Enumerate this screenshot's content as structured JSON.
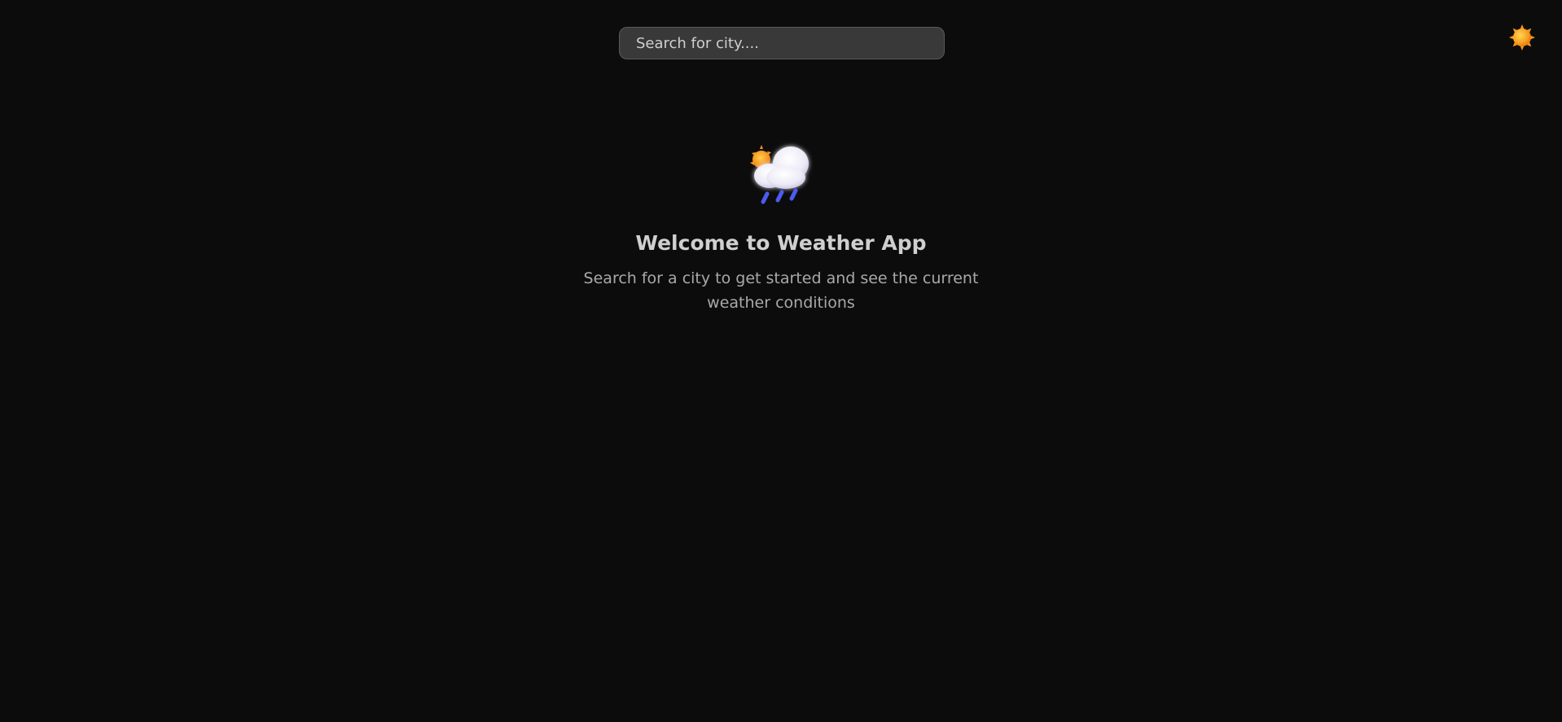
{
  "search": {
    "placeholder": "Search for city....",
    "value": ""
  },
  "header": {
    "theme_toggle_icon": "sun-icon"
  },
  "welcome": {
    "icon": "cloud-sun-rain-icon",
    "title": "Welcome to Weather App",
    "subtitle": "Search for a city to get started and see the current weather conditions"
  },
  "colors": {
    "background": "#0d0c0c",
    "search_bg": "#3a3939",
    "sun": "#f5a623",
    "rain": "#4b5cf0"
  }
}
